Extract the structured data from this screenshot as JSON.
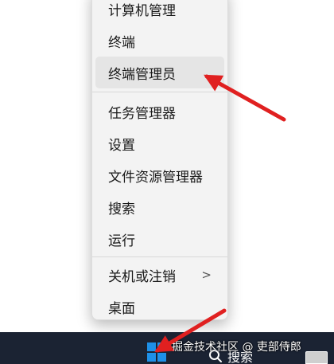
{
  "menu": {
    "items": [
      {
        "label": "计算机管理"
      },
      {
        "label": "终端"
      },
      {
        "label": "终端管理员"
      },
      {
        "label": "任务管理器"
      },
      {
        "label": "设置"
      },
      {
        "label": "文件资源管理器"
      },
      {
        "label": "搜索"
      },
      {
        "label": "运行"
      },
      {
        "label": "关机或注销",
        "submenu_arrow": ">"
      },
      {
        "label": "桌面"
      }
    ]
  },
  "taskbar": {
    "search_label": "搜索"
  },
  "watermark": "掘金技术社区 @ 吏部侍郎",
  "colors": {
    "taskbar_bg": "#1b2333",
    "menu_bg": "#f3f3f3",
    "arrow_red": "#e02020",
    "windows_blue": "#1e90e8"
  }
}
